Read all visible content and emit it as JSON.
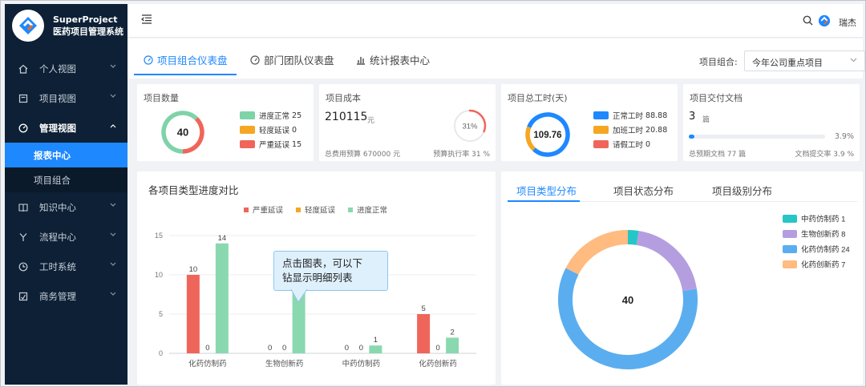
{
  "brand": {
    "title_line1": "SuperProject",
    "title_line2": "医药项目管理系统"
  },
  "sidebar": {
    "items": [
      {
        "label": "个人视图",
        "icon": "home-icon"
      },
      {
        "label": "项目视图",
        "icon": "project-icon"
      },
      {
        "label": "管理视图",
        "icon": "dashboard-icon",
        "open": true,
        "children": [
          {
            "label": "报表中心",
            "active": true
          },
          {
            "label": "项目组合"
          }
        ]
      },
      {
        "label": "知识中心",
        "icon": "book-icon"
      },
      {
        "label": "流程中心",
        "icon": "flow-icon"
      },
      {
        "label": "工时系统",
        "icon": "clock-icon"
      },
      {
        "label": "商务管理",
        "icon": "business-icon"
      }
    ]
  },
  "topbar": {
    "user_name": "瑞杰"
  },
  "tabs": [
    {
      "label": "项目组合仪表盘",
      "active": true
    },
    {
      "label": "部门团队仪表盘"
    },
    {
      "label": "统计报表中心"
    }
  ],
  "combo": {
    "label": "项目组合:",
    "value": "今年公司重点项目"
  },
  "cards": {
    "project_count": {
      "title": "项目数量",
      "total": "40",
      "legend": [
        {
          "label": "进度正常",
          "value": "25",
          "color": "#7ed3a8"
        },
        {
          "label": "轻度延误",
          "value": "0",
          "color": "#f5a623"
        },
        {
          "label": "严重延误",
          "value": "15",
          "color": "#f0655a"
        }
      ]
    },
    "project_cost": {
      "title": "项目成本",
      "value": "210115",
      "unit": "元",
      "percent": "31%",
      "percent_value": 31,
      "budget_label": "总费用预算 670000 元",
      "execution_label": "预算执行率 31 %"
    },
    "work_hours": {
      "title": "项目总工时(天)",
      "total": "109.76",
      "legend": [
        {
          "label": "正常工时",
          "value": "88.88",
          "color": "#1e88ff"
        },
        {
          "label": "加班工时",
          "value": "20.88",
          "color": "#f5a623"
        },
        {
          "label": "请假工时",
          "value": "0",
          "color": "#f0655a"
        }
      ]
    },
    "deliverables": {
      "title": "项目交付文档",
      "value": "3",
      "unit": "篇",
      "progress_percent": 3.9,
      "progress_label": "3.9%",
      "expected_label": "总预期文档 77 篇",
      "rate_label": "文档提交率 3.9 %"
    }
  },
  "progress_panel": {
    "title": "各项目类型进度对比"
  },
  "distribution_panel": {
    "tabs": [
      {
        "label": "项目类型分布",
        "active": true
      },
      {
        "label": "项目状态分布"
      },
      {
        "label": "项目级别分布"
      }
    ]
  },
  "tooltip": {
    "line1": "点击图表，可以下",
    "line2": "钻显示明细列表"
  },
  "chart_data": [
    {
      "type": "bar",
      "title": "",
      "categories": [
        "化药仿制药",
        "生物创新药",
        "中药仿制药",
        "化药创新药"
      ],
      "series": [
        {
          "name": "严重延误",
          "color": "#f0655a",
          "values": [
            10,
            0,
            0,
            5
          ]
        },
        {
          "name": "轻度延误",
          "color": "#f5a623",
          "values": [
            0,
            0,
            0,
            0
          ]
        },
        {
          "name": "进度正常",
          "color": "#8ad8b0",
          "values": [
            14,
            8,
            1,
            2
          ]
        }
      ],
      "yticks": [
        "0",
        "5",
        "10",
        "15"
      ],
      "ylim": [
        0,
        15
      ],
      "grid": true,
      "legend": "top-center"
    },
    {
      "type": "pie",
      "donut": true,
      "center_label": "40",
      "slices": [
        {
          "label": "中药仿制药",
          "value": 1,
          "color": "#26c6c6"
        },
        {
          "label": "生物创新药",
          "value": 8,
          "color": "#b49ee0"
        },
        {
          "label": "化药仿制药",
          "value": 24,
          "color": "#5aaef0"
        },
        {
          "label": "化药创新药",
          "value": 7,
          "color": "#ffbb80"
        }
      ],
      "legend": "top-right"
    }
  ]
}
